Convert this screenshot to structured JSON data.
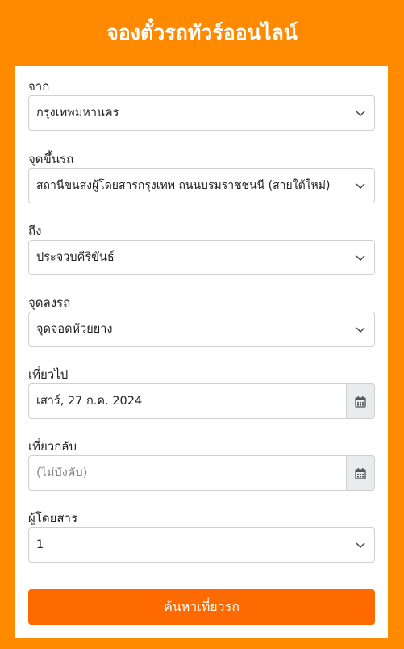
{
  "header": {
    "title": "จองตั๋วรถทัวร์ออนไลน์"
  },
  "form": {
    "from": {
      "label": "จาก",
      "value": "กรุงเทพมหานคร"
    },
    "pickup": {
      "label": "จุดขึ้นรถ",
      "value": "สถานีขนส่งผู้โดยสารกรุงเทพ ถนนบรมราชชนนี (สายใต้ใหม่)"
    },
    "to": {
      "label": "ถึง",
      "value": "ประจวบคีรีขันธ์"
    },
    "dropoff": {
      "label": "จุดลงรถ",
      "value": "จุดจอดห้วยยาง"
    },
    "depart": {
      "label": "เที่ยวไป",
      "value": "เสาร์, 27 ก.ค. 2024"
    },
    "return": {
      "label": "เที่ยวกลับ",
      "placeholder": "(ไม่บังคับ)"
    },
    "passengers": {
      "label": "ผู้โดยสาร",
      "value": "1"
    },
    "submit_label": "ค้นหาเที่ยวรถ"
  },
  "colors": {
    "background": "#ff8a00",
    "button": "#ff6a00"
  },
  "icons": {
    "dropdown": "chevron-down-icon",
    "calendar": "calendar-icon"
  }
}
